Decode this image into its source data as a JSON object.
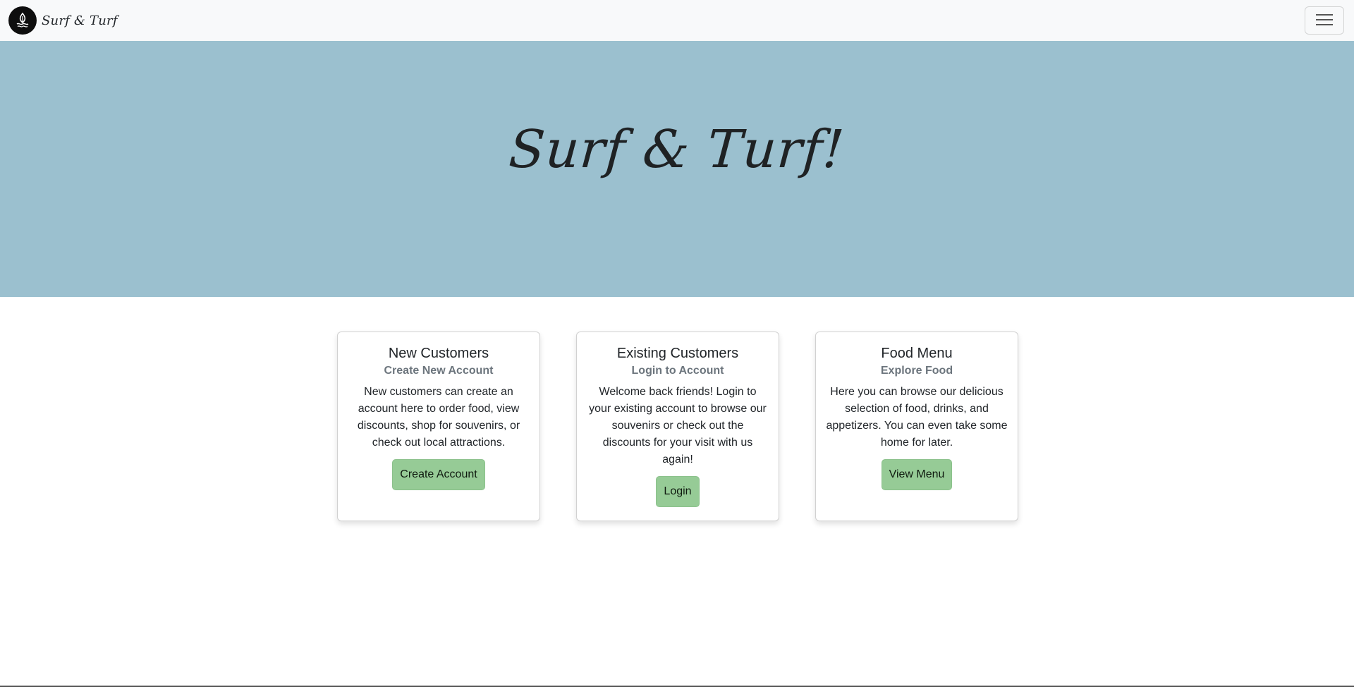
{
  "navbar": {
    "brand": "Surf & Turf",
    "logo_icon": "surf-turf-logo-icon",
    "menu_icon": "hamburger-menu-icon",
    "background": "#f8f9fa"
  },
  "hero": {
    "title": "Surf & Turf!",
    "background": "#9bc0cf"
  },
  "cards": [
    {
      "title": "New Customers",
      "subtitle": "Create New Account",
      "text": "New customers can create an account here to order food, view discounts, shop for souvenirs, or check out local attractions.",
      "button": "Create Account"
    },
    {
      "title": "Existing Customers",
      "subtitle": "Login to Account",
      "text": "Welcome back friends! Login to your existing account to browse our souvenirs or check out the discounts for your visit with us again!",
      "button": "Login"
    },
    {
      "title": "Food Menu",
      "subtitle": "Explore Food",
      "text": "Here you can browse our delicious selection of food, drinks, and appetizers. You can even take some home for later.",
      "button": "View Menu"
    }
  ],
  "colors": {
    "button": "#96cb96",
    "subtitle": "#6c757d"
  }
}
